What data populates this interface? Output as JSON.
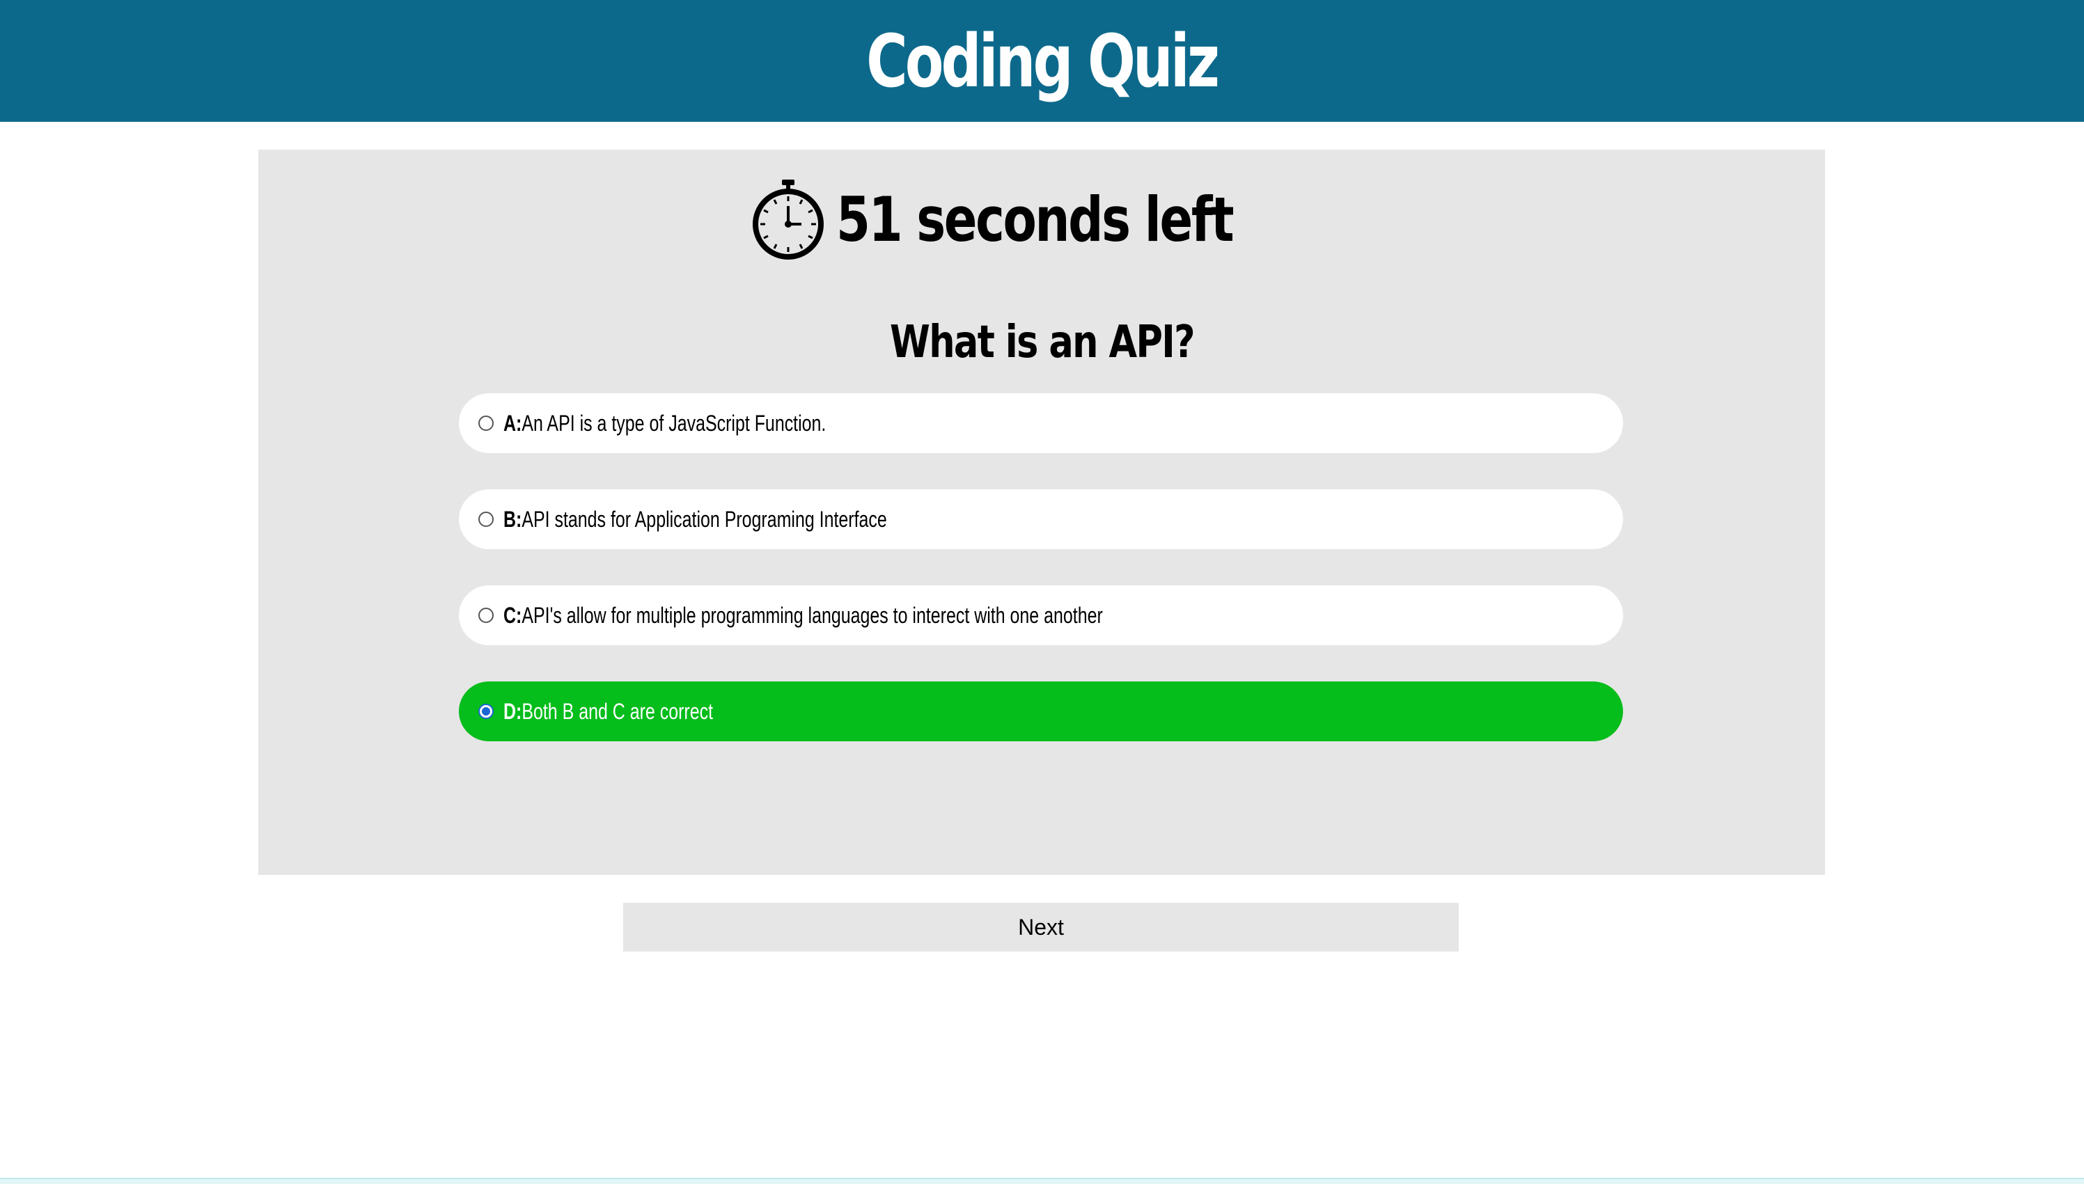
{
  "header": {
    "title": "Coding Quiz"
  },
  "timer": {
    "icon": "stopwatch-icon",
    "text": "51 seconds left"
  },
  "question": {
    "text": "What is an API?"
  },
  "options": [
    {
      "letter": "A:",
      "text": "An API is a type of JavaScript Function.",
      "selected": false
    },
    {
      "letter": "B:",
      "text": "API stands for Application Programing Interface",
      "selected": false
    },
    {
      "letter": "C:",
      "text": "API's allow for multiple programming languages to interect with one another",
      "selected": false
    },
    {
      "letter": "D:",
      "text": "Both B and C are correct",
      "selected": true
    }
  ],
  "next_button": {
    "label": "Next"
  },
  "colors": {
    "header_bg": "#0d698b",
    "panel_bg": "#e6e6e6",
    "selected_bg": "#05bd1b"
  }
}
